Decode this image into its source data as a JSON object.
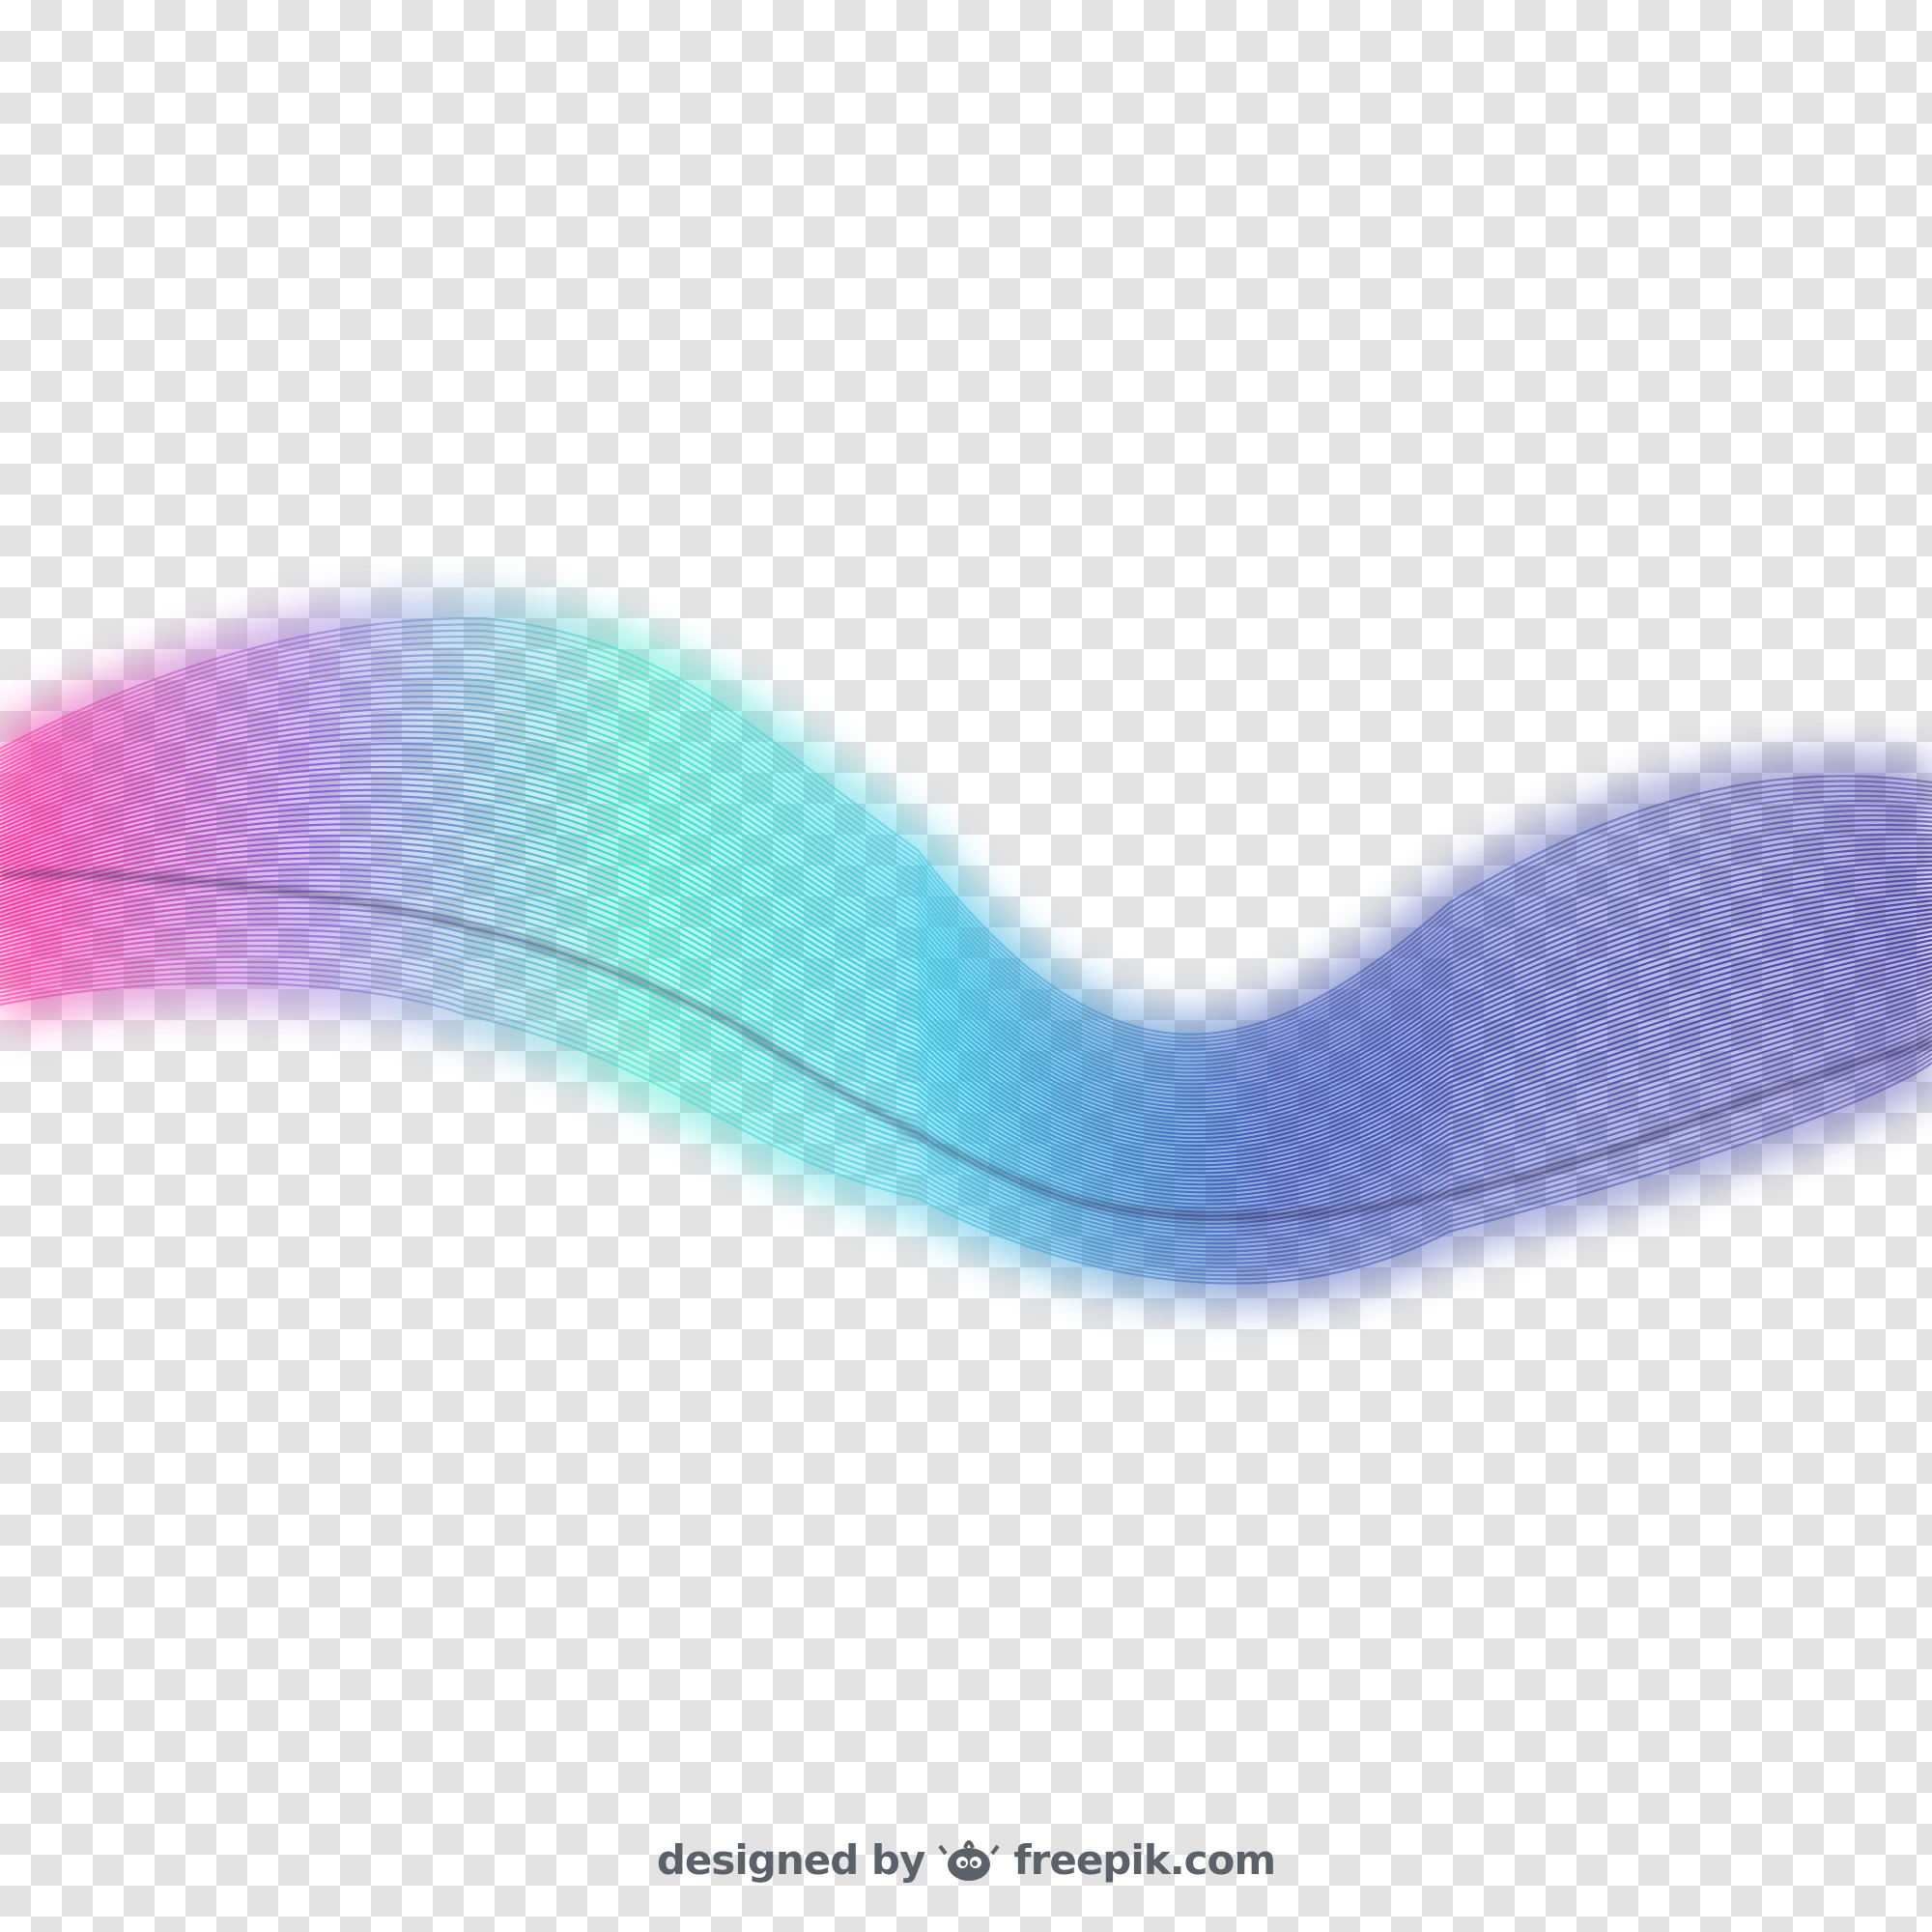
{
  "artwork": {
    "subject": "abstract-line-wave",
    "colors": {
      "pink": "#ff2fa0",
      "violet": "#8a5cd6",
      "turquoise": "#2fe6c8",
      "cyan": "#35c7e6",
      "blue": "#3a54b8",
      "indigo": "#4a3fa8",
      "checker_light": "#ffffff",
      "checker_dark": "#e3e3e3"
    }
  },
  "credit": {
    "prefix": "designed by",
    "brand": "freepik.com",
    "logo_icon": "freepik-logo-icon"
  }
}
